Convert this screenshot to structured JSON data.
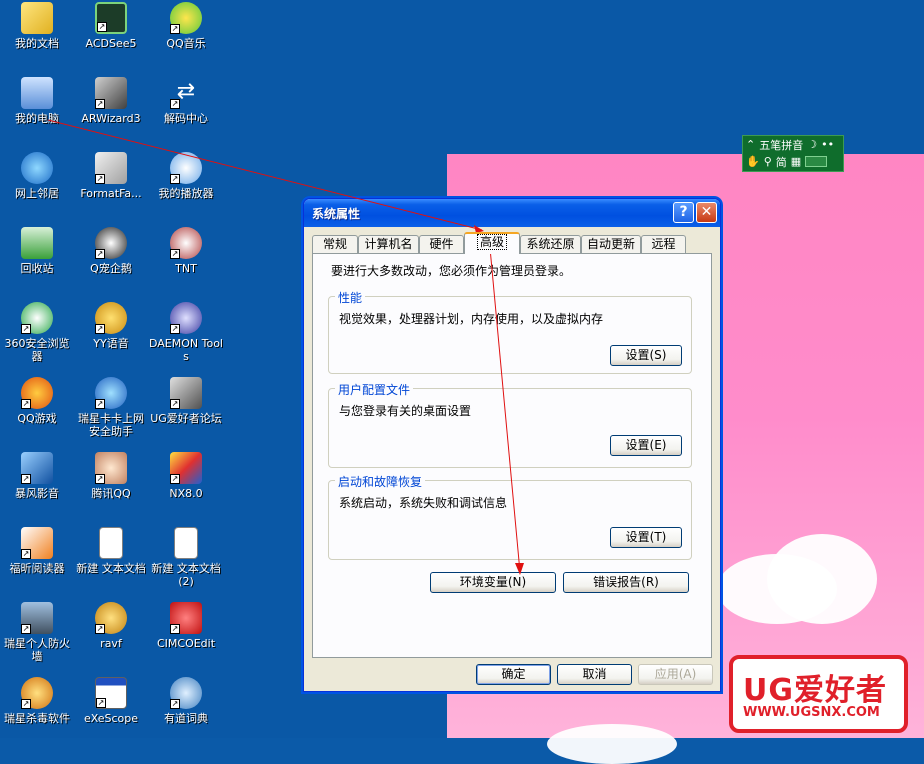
{
  "desktop_icons": [
    {
      "label": "我的文档",
      "icon": "my-documents-icon"
    },
    {
      "label": "ACDSee5",
      "icon": "acdsee-icon"
    },
    {
      "label": "QQ音乐",
      "icon": "qq-music-icon"
    },
    {
      "label": "我的电脑",
      "icon": "my-computer-icon"
    },
    {
      "label": "ARWizard3",
      "icon": "arwizard-icon"
    },
    {
      "label": "解码中心",
      "icon": "decoder-icon"
    },
    {
      "label": "网上邻居",
      "icon": "network-icon"
    },
    {
      "label": "FormatFa...",
      "icon": "format-factory-icon"
    },
    {
      "label": "我的播放器",
      "icon": "player-icon"
    },
    {
      "label": "回收站",
      "icon": "recycle-bin-icon"
    },
    {
      "label": "Q宠企鹅",
      "icon": "qq-pet-icon"
    },
    {
      "label": "TNT",
      "icon": "tnt-icon"
    },
    {
      "label": "360安全浏览器",
      "icon": "360-browser-icon"
    },
    {
      "label": "YY语音",
      "icon": "yy-voice-icon"
    },
    {
      "label": "DAEMON Tools",
      "icon": "daemon-tools-icon"
    },
    {
      "label": "QQ游戏",
      "icon": "qq-game-icon"
    },
    {
      "label": "瑞星卡卡上网安全助手",
      "icon": "rising-kaka-icon"
    },
    {
      "label": "UG爱好者论坛",
      "icon": "ug-forum-icon"
    },
    {
      "label": "暴风影音",
      "icon": "storm-player-icon"
    },
    {
      "label": "腾讯QQ",
      "icon": "tencent-qq-icon"
    },
    {
      "label": "NX8.0",
      "icon": "nx-icon"
    },
    {
      "label": "福昕阅读器",
      "icon": "foxit-reader-icon"
    },
    {
      "label": "新建 文本文档",
      "icon": "text-doc-icon"
    },
    {
      "label": "新建 文本文档 (2)",
      "icon": "text-doc-icon"
    },
    {
      "label": "瑞星个人防火墙",
      "icon": "rising-firewall-icon"
    },
    {
      "label": "ravf",
      "icon": "ravf-icon"
    },
    {
      "label": "CIMCOEdit",
      "icon": "cimco-edit-icon"
    },
    {
      "label": "瑞星杀毒软件",
      "icon": "rising-antivirus-icon"
    },
    {
      "label": "eXeScope",
      "icon": "exescope-icon"
    },
    {
      "label": "有道词典",
      "icon": "youdao-dict-icon"
    }
  ],
  "ime": {
    "name": "五笔拼音",
    "mode": "简"
  },
  "dialog": {
    "title": "系统属性",
    "help_label": "?",
    "close_label": "✕",
    "tabs": [
      "常规",
      "计算机名",
      "硬件",
      "高级",
      "系统还原",
      "自动更新",
      "远程"
    ],
    "active_tab": "高级",
    "admin_note": "要进行大多数改动，您必须作为管理员登录。",
    "groups": [
      {
        "label": "性能",
        "desc": "视觉效果，处理器计划，内存使用，以及虚拟内存",
        "button": "设置(S)"
      },
      {
        "label": "用户配置文件",
        "desc": "与您登录有关的桌面设置",
        "button": "设置(E)"
      },
      {
        "label": "启动和故障恢复",
        "desc": "系统启动，系统失败和调试信息",
        "button": "设置(T)"
      }
    ],
    "env_button": "环境变量(N)",
    "error_button": "错误报告(R)",
    "ok_button": "确定",
    "cancel_button": "取消",
    "apply_button": "应用(A)"
  },
  "watermark": {
    "brand": "UG爱好者",
    "url": "WWW.UGSNX.COM"
  },
  "colors": {
    "desktop": "#0a58a6",
    "title_bar": "#0050e0",
    "arrow": "#e01010",
    "brand": "#e0202a"
  }
}
